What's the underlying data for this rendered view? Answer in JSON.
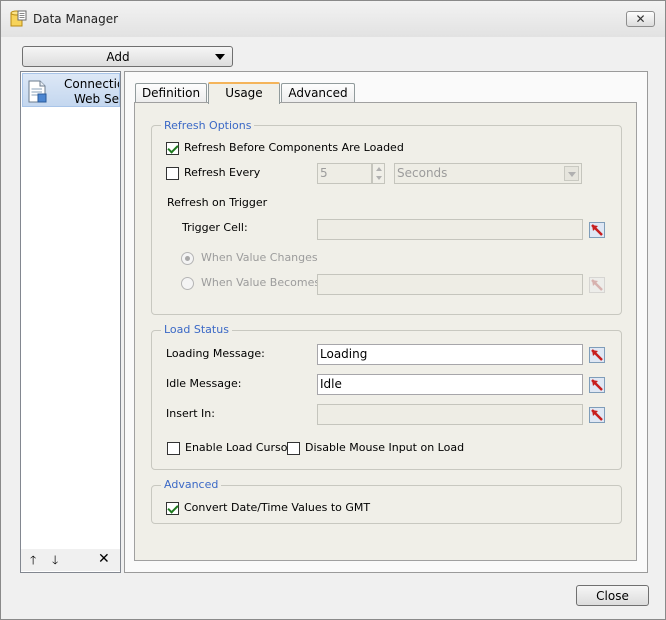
{
  "window": {
    "title": "Data Manager",
    "close_glyph": "✕"
  },
  "toolbar": {
    "add_label": "Add"
  },
  "list": {
    "items": [
      {
        "line1": "Connection",
        "line2": "Web Service"
      }
    ],
    "tools": {
      "up": "🡑",
      "down": "🡓",
      "delete": "✕"
    }
  },
  "tabs": [
    {
      "label": "Definition"
    },
    {
      "label": "Usage",
      "active": true
    },
    {
      "label": "Advanced"
    }
  ],
  "refresh_options": {
    "legend": "Refresh Options",
    "refresh_before_label": "Refresh Before Components Are Loaded",
    "refresh_before_checked": true,
    "refresh_every_label": "Refresh Every",
    "refresh_every_checked": false,
    "interval_value": "5",
    "interval_unit": "Seconds",
    "on_trigger_label": "Refresh on Trigger",
    "trigger_cell_label": "Trigger Cell:",
    "trigger_cell_value": "",
    "when_changes_label": "When Value Changes",
    "when_becomes_label": "When Value Becomes",
    "when_becomes_value": ""
  },
  "load_status": {
    "legend": "Load Status",
    "loading_label": "Loading Message:",
    "loading_value": "Loading",
    "idle_label": "Idle Message:",
    "idle_value": "Idle",
    "insert_label": "Insert In:",
    "insert_value": "",
    "load_cursor_label": "Enable Load Cursor",
    "disable_mouse_label": "Disable Mouse Input on Load"
  },
  "advanced": {
    "legend": "Advanced",
    "convert_gmt_label": "Convert Date/Time Values to GMT",
    "convert_gmt_checked": true
  },
  "footer": {
    "close_label": "Close"
  },
  "colors": {
    "accent_blue": "#3b69c6",
    "tab_highlight": "#f4b45a"
  }
}
